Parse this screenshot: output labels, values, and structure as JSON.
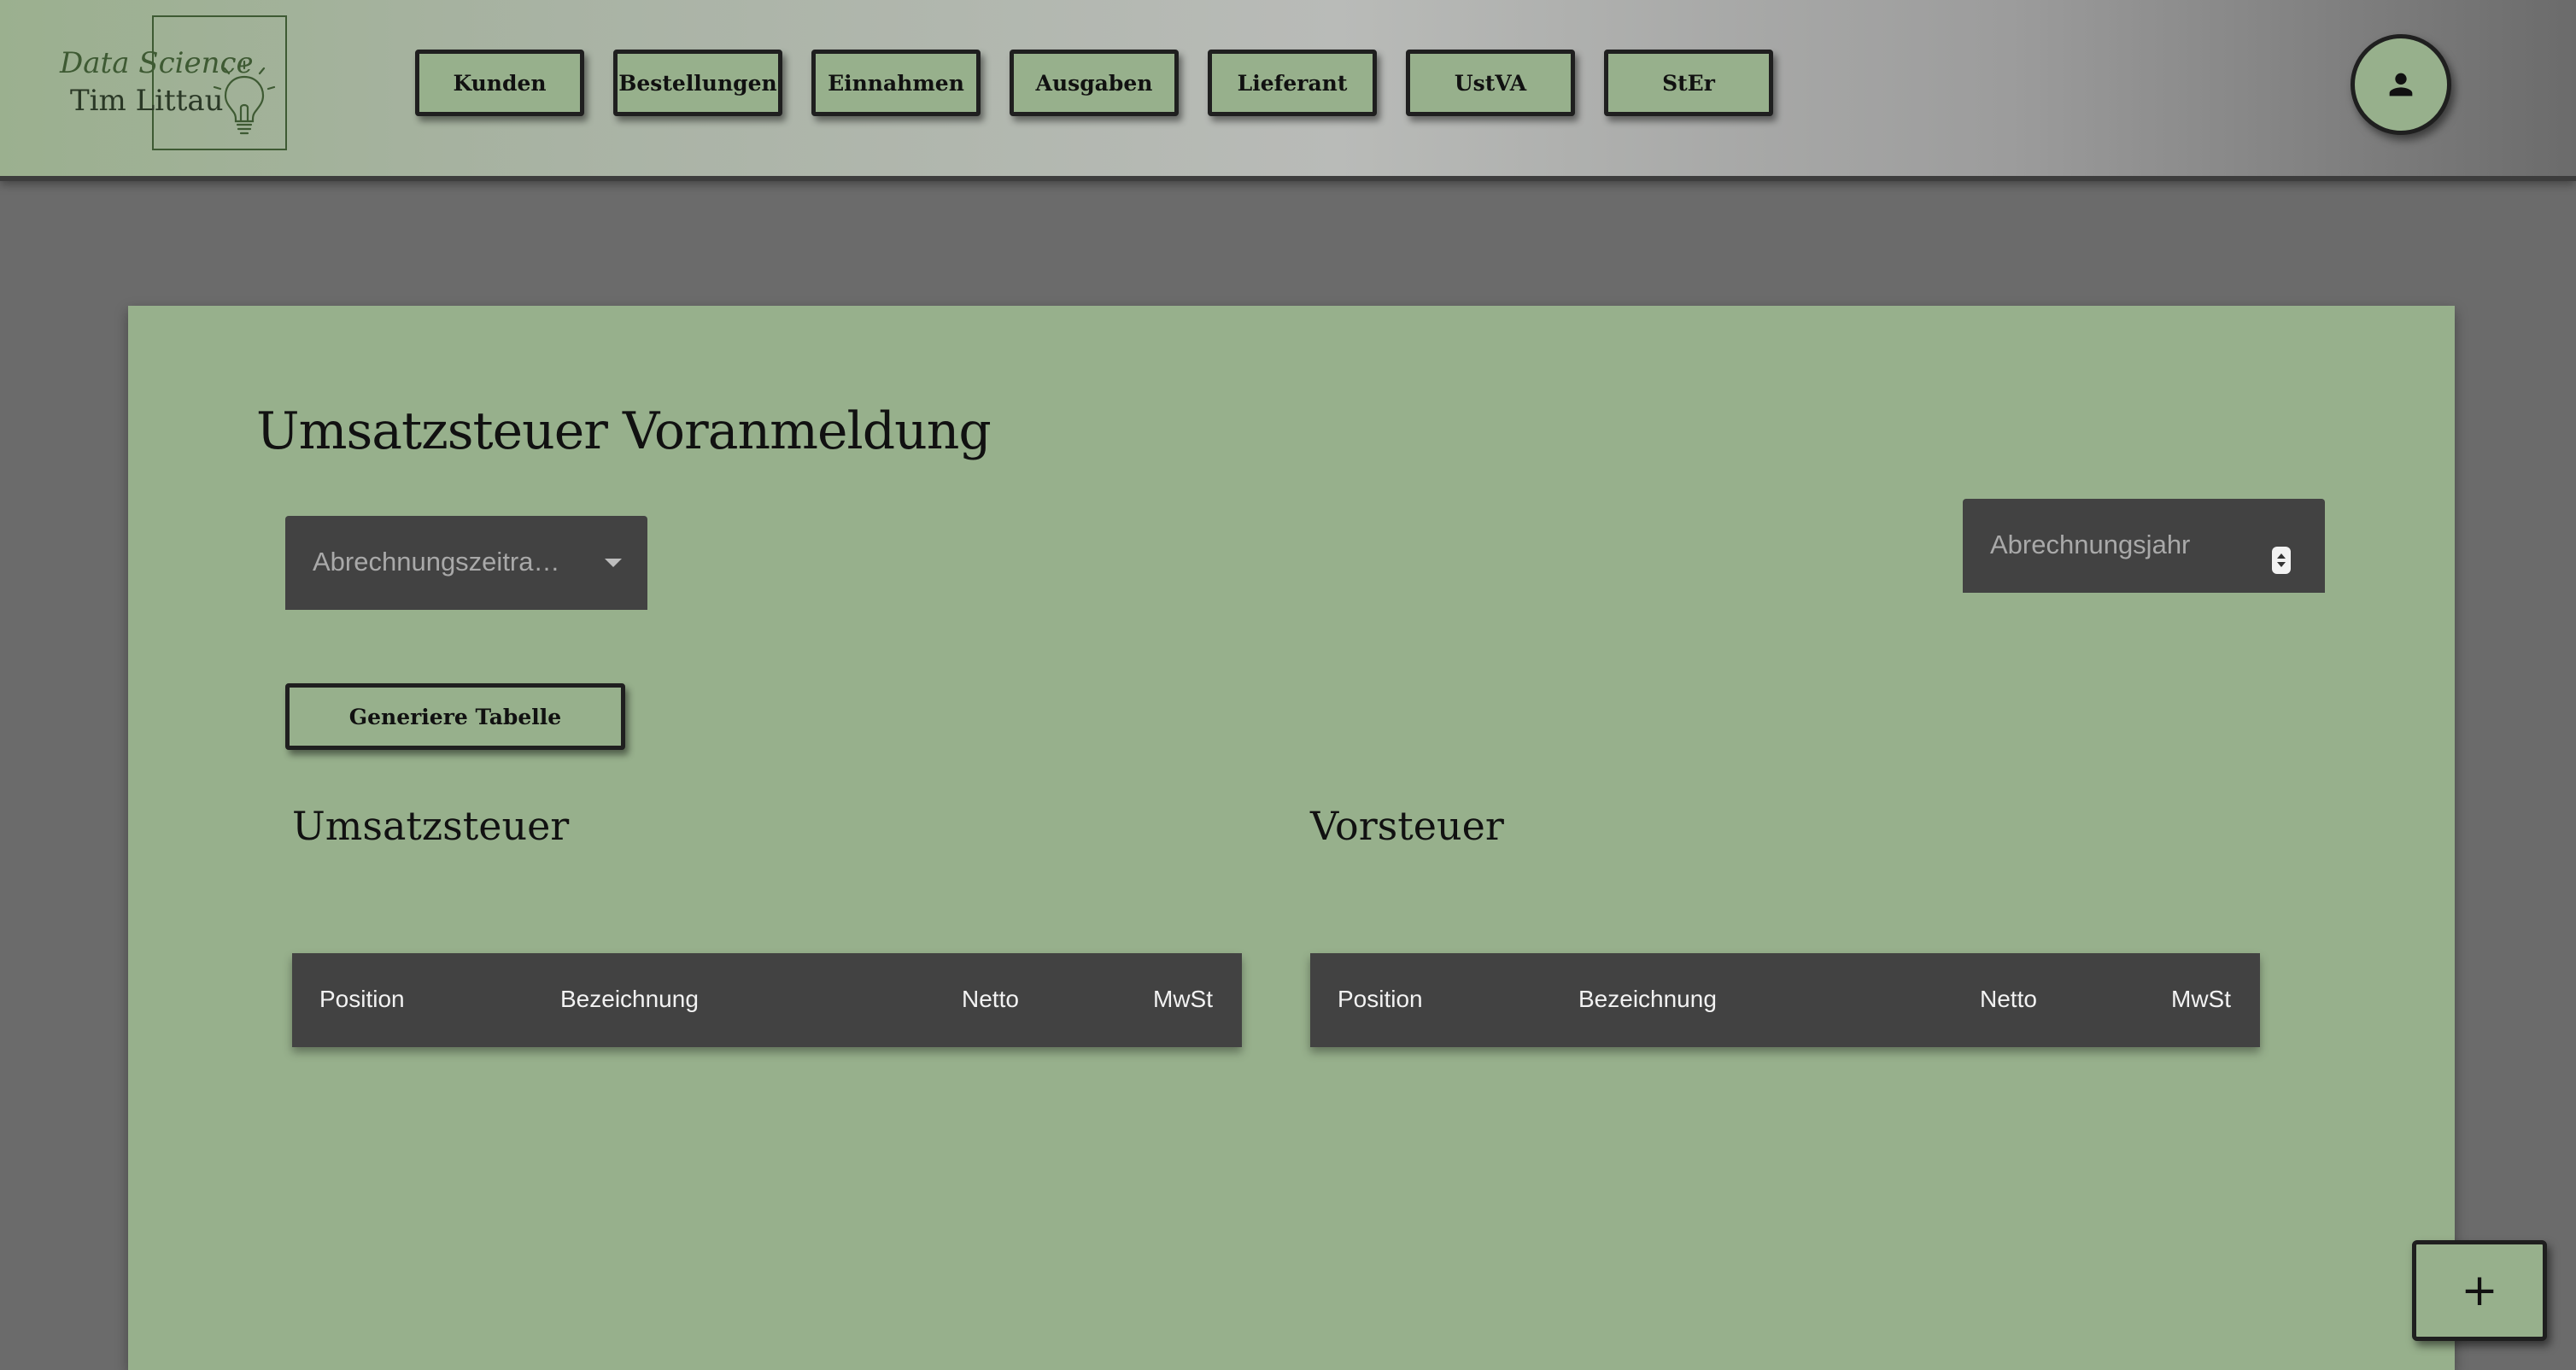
{
  "logo": {
    "line1": "Data Science",
    "line2": "Tim Littau",
    "icon": "lightbulb-icon"
  },
  "nav": {
    "items": [
      "Kunden",
      "Bestellungen",
      "Einnahmen",
      "Ausgaben",
      "Lieferant",
      "UstVA",
      "StEr"
    ]
  },
  "header": {
    "avatar_icon": "person-icon"
  },
  "main": {
    "title": "Umsatzsteuer Voranmeldung",
    "period_select": {
      "placeholder": "Abrechnungszeitra…",
      "icon": "chevron-down-icon"
    },
    "year_input": {
      "placeholder": "Abrechnungsjahr",
      "icon": "spinner-icon"
    },
    "generate_button": "Generiere Tabelle",
    "sections": {
      "sales_tax": {
        "title": "Umsatzsteuer",
        "columns": [
          "Position",
          "Bezeichnung",
          "Netto",
          "MwSt"
        ]
      },
      "input_tax": {
        "title": "Vorsteuer",
        "columns": [
          "Position",
          "Bezeichnung",
          "Netto",
          "MwSt"
        ]
      }
    }
  },
  "fab": {
    "label": "+"
  },
  "colors": {
    "accent_green": "#97b08c",
    "dark_surface": "#424242",
    "page_background": "#6b6b6b",
    "border": "#1f1f1f"
  }
}
